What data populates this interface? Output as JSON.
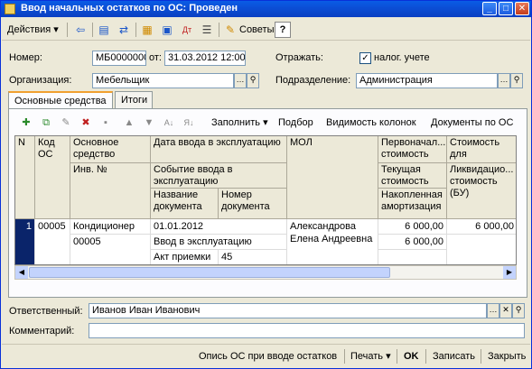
{
  "window": {
    "title": "Ввод начальных остатков по ОС: Проведен",
    "min": "_",
    "max": "□",
    "close": "✕"
  },
  "toolbar": {
    "actions_label": "Действия",
    "tips_label": "Советы",
    "help_label": "?"
  },
  "header": {
    "number_label": "Номер:",
    "number_value": "МБ0000000",
    "from_label": "от:",
    "date_value": "31.03.2012 12:00:00",
    "reflect_label": "Отражать:",
    "tax_label": "налог. учете",
    "tax_checked": "✓",
    "org_label": "Организация:",
    "org_value": "Мебельщик",
    "dept_label": "Подразделение:",
    "dept_value": "Администрация"
  },
  "tabs": [
    "Основные средства",
    "Итоги"
  ],
  "panel_toolbar": {
    "fill_label": "Заполнить",
    "pick_label": "Подбор",
    "columns_label": "Видимость колонок",
    "docs_label": "Документы по ОС"
  },
  "grid": {
    "headers": {
      "n": "N",
      "code": "Код ОС",
      "asset": "Основное средство",
      "inv": "Инв. №",
      "date": "Дата ввода в эксплуатацию",
      "event": "Событие ввода в эксплуатацию",
      "doc_name": "Название документа",
      "doc_num": "Номер документа",
      "mol": "МОЛ",
      "initial_cost": "Первоначал... стоимость",
      "current_cost": "Текущая стоимость",
      "acc_amort": "Накопленная амортизация",
      "cost_for": "Стоимость для",
      "liquid_cost": "Ликвидацио... стоимость (БУ)"
    },
    "rows": [
      {
        "n": "1",
        "code": "00005",
        "asset": "Кондиционер",
        "inv": "00005",
        "date": "01.01.2012",
        "event": "Ввод в эксплуатацию",
        "doc_name": "Акт приемки",
        "doc_num": "45",
        "mol": "Александрова Елена Андреевна",
        "initial_cost": "6 000,00",
        "current_cost": "6 000,00",
        "cost_for": "6 000,00"
      }
    ]
  },
  "footer": {
    "resp_label": "Ответственный:",
    "resp_value": "Иванов Иван Иванович",
    "comment_label": "Комментарий:",
    "comment_value": ""
  },
  "bottombar": {
    "inventory_label": "Опись ОС при вводе остатков",
    "print_label": "Печать",
    "ok_label": "OK",
    "save_label": "Записать",
    "close_label": "Закрыть"
  }
}
